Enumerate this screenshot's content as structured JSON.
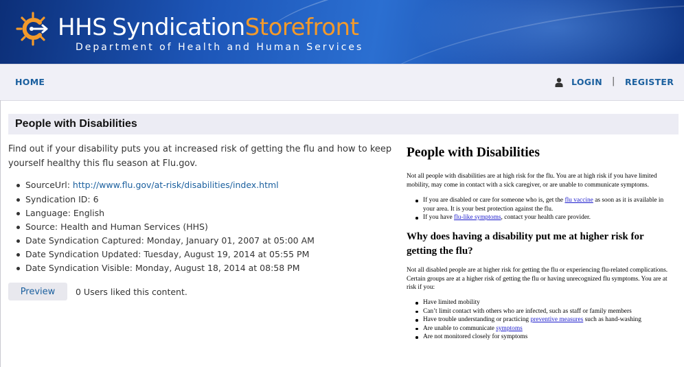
{
  "header": {
    "logo_hhs": "HHS",
    "logo_syndication": "Syndication",
    "logo_storefront": "Storefront",
    "logo_subtitle": "Department of Health and Human Services",
    "brand_orange": "#f39a2b",
    "banner_blue": "#1d56b8"
  },
  "nav": {
    "home": "HOME",
    "login": "LOGIN",
    "separator": "|",
    "register": "REGISTER",
    "user_icon": "user-icon",
    "link_color": "#1a5f9e"
  },
  "content": {
    "title": "People with Disabilities",
    "description": "Find out if your disability puts you at increased risk of getting the flu and how to keep yourself healthy this flu season at Flu.gov.",
    "meta": {
      "source_url_label": "SourceUrl: ",
      "source_url": "http://www.flu.gov/at-risk/disabilities/index.html",
      "syndication_id": "Syndication ID: 6",
      "language": "Language: English",
      "source": "Source: Health and Human Services (HHS)",
      "captured": "Date Syndication Captured: Monday, January 01, 2007 at 05:00 AM",
      "updated": "Date Syndication Updated: Tuesday, August 19, 2014 at 05:55 PM",
      "visible": "Date Syndication Visible: Monday, August 18, 2014 at 08:58 PM"
    },
    "preview_button": "Preview",
    "likes": "0 Users liked this content."
  },
  "preview": {
    "heading": "People with Disabilities",
    "intro": "Not all people with disabilities are at high risk for the flu. You are at high risk if you have limited mobility, may come in contact with a sick caregiver, or are unable to communicate symptoms.",
    "list1": [
      {
        "before": "If you are disabled or care for someone who is, get the ",
        "link": "flu vaccine",
        "after": " as soon as it is available in your area. It is your best protection against the flu."
      },
      {
        "before": "If you have ",
        "link": "flu-like symptoms",
        "after": ", contact your health care provider."
      }
    ],
    "heading2": "Why does having a disability put me at higher risk for getting the flu?",
    "para2": "Not all disabled people are at higher risk for getting the flu or experiencing flu-related complications. Certain groups are at a higher risk of getting the flu or having unrecognized flu symptoms. You are at risk if you:",
    "list2": [
      {
        "before": "Have limited mobility",
        "link": "",
        "after": ""
      },
      {
        "before": "Can’t limit contact with others who are infected, such as staff or family members",
        "link": "",
        "after": ""
      },
      {
        "before": "Have trouble understanding or practicing ",
        "link": "preventive measures",
        "after": " such as hand-washing"
      },
      {
        "before": "Are unable to communicate ",
        "link": "symptoms",
        "after": ""
      },
      {
        "before": "Are not monitored closely for symptoms",
        "link": "",
        "after": ""
      }
    ]
  }
}
